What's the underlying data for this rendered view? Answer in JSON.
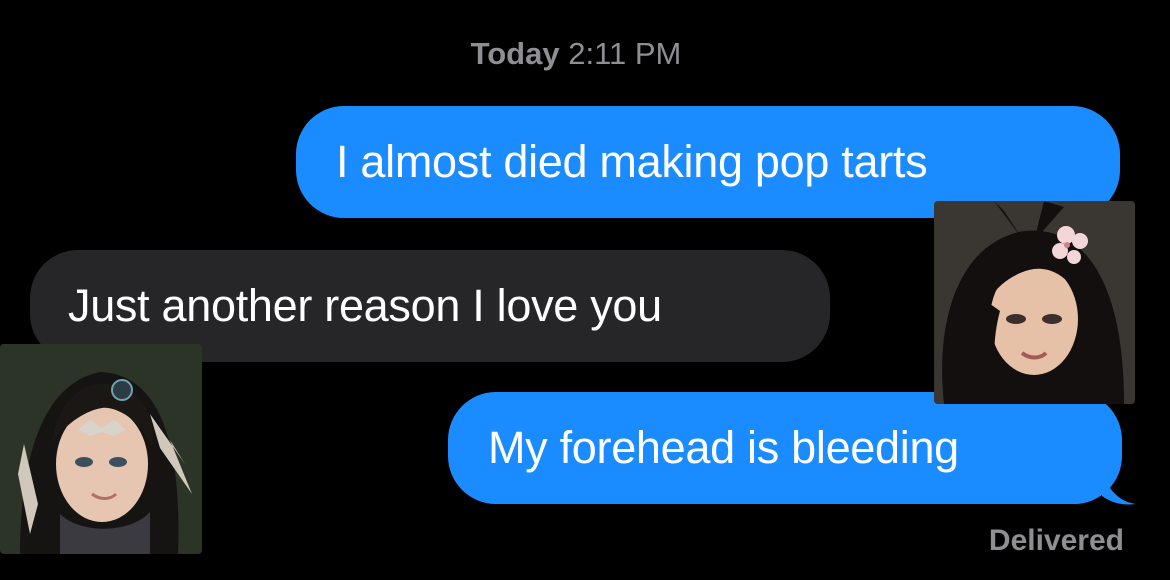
{
  "conversation": {
    "timestamp_day": "Today",
    "timestamp_time": "2:11 PM",
    "messages": [
      {
        "direction": "sent",
        "text": "I almost died making pop tarts"
      },
      {
        "direction": "received",
        "text": "Just another reason I love you"
      },
      {
        "direction": "sent",
        "text": "My forehead is bleeding"
      }
    ],
    "status": "Delivered"
  },
  "colors": {
    "background": "#000000",
    "sent_bubble": "#1b8cff",
    "received_bubble": "#262628",
    "meta_text": "#8e8e93"
  },
  "avatars": [
    {
      "name": "character-portrait-left"
    },
    {
      "name": "character-portrait-right"
    }
  ]
}
